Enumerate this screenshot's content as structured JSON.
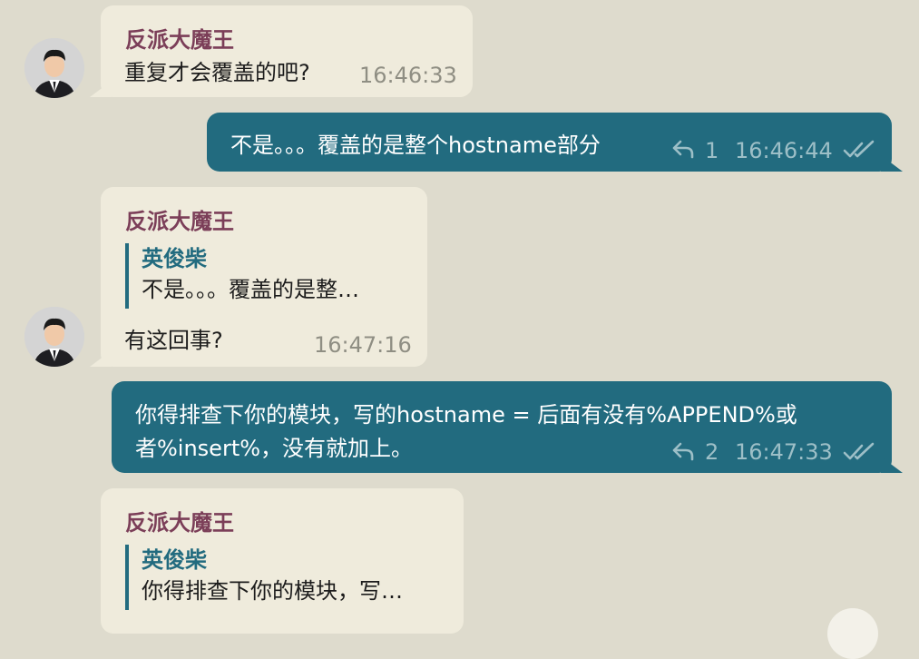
{
  "messages": [
    {
      "sender": "反派大魔王",
      "text": "重复才会覆盖的吧?",
      "time": "16:46:33"
    },
    {
      "text": "不是。。。覆盖的是整个hostname部分",
      "reply_count": "1",
      "time": "16:46:44"
    },
    {
      "sender": "反派大魔王",
      "quote_name": "英俊柴",
      "quote_text": "不是。。。覆盖的是整…",
      "text": "有这回事?",
      "time": "16:47:16"
    },
    {
      "text_line1": "你得排查下你的模块，写的hostname = 后面有没有%APPEND%或",
      "text_line2": "者%insert%，没有就加上。",
      "reply_count": "2",
      "time": "16:47:33"
    },
    {
      "sender": "反派大魔王",
      "quote_name": "英俊柴",
      "quote_text": "你得排查下你的模块，写…"
    }
  ],
  "colors": {
    "background": "#dedbcd",
    "incoming": "#efebdc",
    "outgoing": "#226b7f",
    "sender": "#7b3e58"
  },
  "icons": [
    "avatar",
    "reply-icon",
    "double-check-icon"
  ]
}
